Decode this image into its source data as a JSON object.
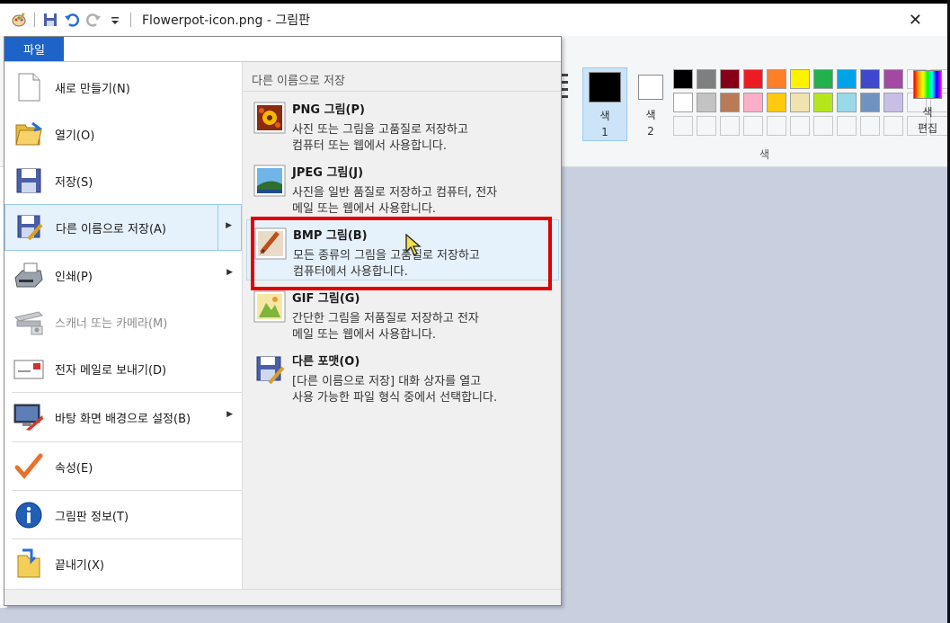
{
  "titlebar": {
    "title": "Flowerpot-icon.png - 그림판",
    "close_glyph": "✕"
  },
  "file_tab": {
    "label": "파일"
  },
  "left_menu": [
    {
      "label": "새로 만들기(N)",
      "icon": "new-doc-icon"
    },
    {
      "label": "열기(O)",
      "icon": "open-folder-icon"
    },
    {
      "label": "저장(S)",
      "icon": "save-icon"
    },
    {
      "label": "다른 이름으로 저장(A)",
      "icon": "save-as-icon",
      "has_submenu": true,
      "active": true
    },
    {
      "label": "인쇄(P)",
      "icon": "printer-icon",
      "has_submenu": true
    },
    {
      "label": "스캐너 또는 카메라(M)",
      "icon": "scanner-icon",
      "disabled": true
    },
    {
      "label": "전자 메일로 보내기(D)",
      "icon": "email-icon"
    },
    {
      "label": "바탕 화면 배경으로 설정(B)",
      "icon": "desktop-background-icon",
      "has_submenu": true
    },
    {
      "label": "속성(E)",
      "icon": "checkmark-icon"
    },
    {
      "label": "그림판 정보(T)",
      "icon": "info-icon"
    },
    {
      "label": "끝내기(X)",
      "icon": "exit-icon"
    }
  ],
  "submenu": {
    "header": "다른 이름으로 저장",
    "items": [
      {
        "title": "PNG 그림(P)",
        "line1": "사진 또는 그림을 고품질로 저장하고",
        "line2": "컴퓨터 또는 웹에서 사용합니다.",
        "icon": "png-image-icon"
      },
      {
        "title": "JPEG 그림(J)",
        "line1": "사진을 일반 품질로 저장하고 컴퓨터, 전자",
        "line2": "메일 또는 웹에서 사용합니다.",
        "icon": "jpeg-image-icon"
      },
      {
        "title": "BMP 그림(B)",
        "line1": "모든 종류의 그림을 고품질로 저장하고",
        "line2": "컴퓨터에서 사용합니다.",
        "icon": "bmp-image-icon",
        "hover": true
      },
      {
        "title": "GIF 그림(G)",
        "line1": "간단한 그림을 저품질로 저장하고 전자",
        "line2": "메일 또는 웹에서 사용합니다.",
        "icon": "gif-image-icon"
      },
      {
        "title": "다른 포맷(O)",
        "line1": "[다른 이름으로 저장] 대화 상자를 열고",
        "line2": "사용 가능한 파일 형식 중에서 선택합니다.",
        "icon": "other-format-icon"
      }
    ]
  },
  "ribbon": {
    "color1_label_a": "색",
    "color1_label_b": "1",
    "color2_label_a": "색",
    "color2_label_b": "2",
    "edit_colors_a": "색",
    "edit_colors_b": "편집",
    "group_label": "색",
    "palette_row1": [
      "#000000",
      "#7f7f7f",
      "#880015",
      "#ed1c24",
      "#ff7f27",
      "#fff200",
      "#22b14c",
      "#00a2e8",
      "#3f48cc",
      "#a349a4"
    ],
    "palette_row2": [
      "#ffffff",
      "#c3c3c3",
      "#b97a57",
      "#ffaec9",
      "#ffc90e",
      "#efe4b0",
      "#b5e61d",
      "#99d9ea",
      "#7092be",
      "#c8bfe7"
    ]
  },
  "colors": {
    "file_tab": "#1e64c8",
    "highlight": "#e00000",
    "hover_bg": "#e5f1fb"
  }
}
